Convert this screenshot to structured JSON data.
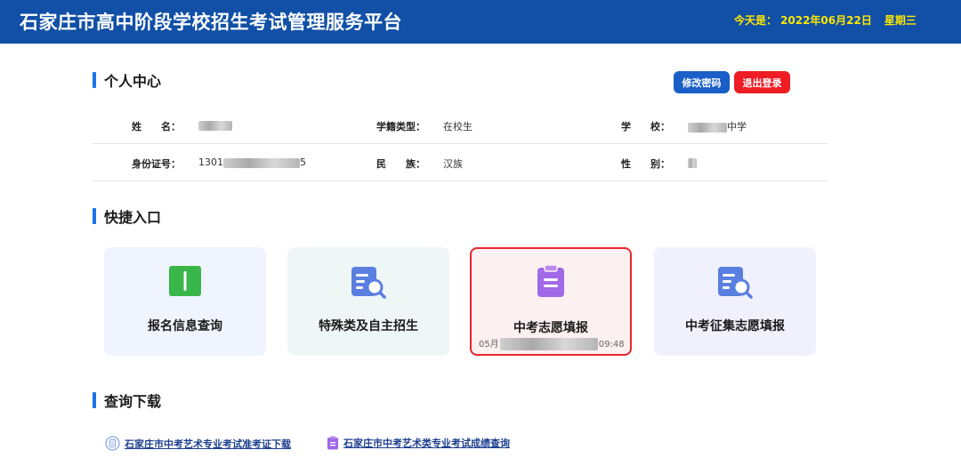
{
  "header": {
    "title": "石家庄市高中阶段学校招生考试管理服务平台",
    "date_label": "今天是：",
    "date": "2022年06月22日",
    "weekday": "星期三"
  },
  "personal": {
    "title": "个人中心",
    "change_password": "修改密码",
    "logout": "退出登录",
    "fields": {
      "name_label": "姓　　名：",
      "name_value": "",
      "status_label": "学籍类型：",
      "status_value": "在校生",
      "school_label": "学　　校：",
      "school_value": "中学",
      "id_label": "身份证号：",
      "id_prefix": "1301",
      "id_suffix": "5",
      "ethnic_label": "民　　族：",
      "ethnic_value": "汉族",
      "gender_label": "性　　别："
    }
  },
  "shortcuts": {
    "title": "快捷入口",
    "cards": [
      {
        "label": "报名信息查询",
        "icon": "book-icon"
      },
      {
        "label": "特殊类及自主招生",
        "icon": "document-search-icon"
      },
      {
        "label": "中考志愿填报",
        "icon": "clipboard-icon",
        "sub_prefix": "05月",
        "sub_suffix": "09:48"
      },
      {
        "label": "中考征集志愿填报",
        "icon": "document-search-icon"
      }
    ]
  },
  "downloads": {
    "title": "查询下载",
    "links": [
      {
        "label": "石家庄市中考艺术专业考试准考证下载",
        "icon": "ticket-icon"
      },
      {
        "label": "石家庄市中考艺术类专业考试成绩查询",
        "icon": "clipboard-icon"
      }
    ]
  },
  "colors": {
    "header_bg": "#1150a6",
    "accent_blue": "#1a73e8",
    "date_yellow": "#ffe600",
    "logout_red": "#ee1c25",
    "highlight_border": "#e8262d"
  }
}
